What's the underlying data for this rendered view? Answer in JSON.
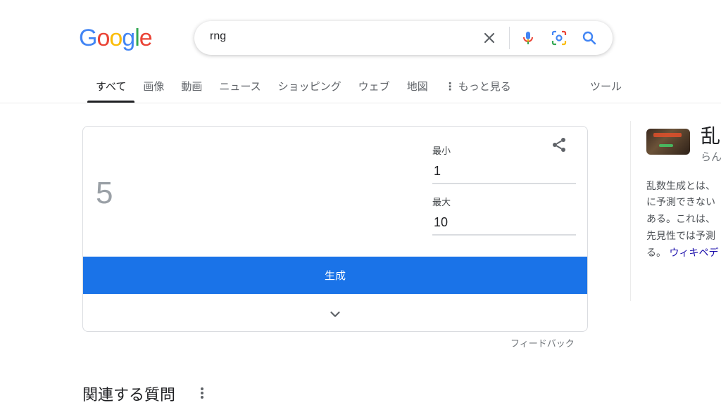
{
  "logo": {
    "letters": [
      "G",
      "o",
      "o",
      "g",
      "l",
      "e"
    ],
    "colors": [
      "#4285F4",
      "#EA4335",
      "#FBBC05",
      "#4285F4",
      "#34A853",
      "#EA4335"
    ]
  },
  "search": {
    "query": "rng"
  },
  "tabs": [
    {
      "label": "すべて",
      "active": true
    },
    {
      "label": "画像"
    },
    {
      "label": "動画"
    },
    {
      "label": "ニュース"
    },
    {
      "label": "ショッピング"
    },
    {
      "label": "ウェブ"
    },
    {
      "label": "地図"
    },
    {
      "label": "もっと見る"
    }
  ],
  "tools_label": "ツール",
  "rng": {
    "result": "5",
    "min_label": "最小",
    "min_value": "1",
    "max_label": "最大",
    "max_value": "10",
    "generate_label": "生成"
  },
  "feedback_label": "フィードバック",
  "related_title": "関連する質問",
  "knowledge_panel": {
    "title": "乱",
    "reading": "らん",
    "lines": [
      "乱数生成とは、",
      "に予測できない",
      "ある。これは、",
      "先見性では予測",
      "る。"
    ],
    "link": "ウィキペデ"
  },
  "colors": {
    "accent": "#1a73e8",
    "link": "#1a0dab"
  }
}
